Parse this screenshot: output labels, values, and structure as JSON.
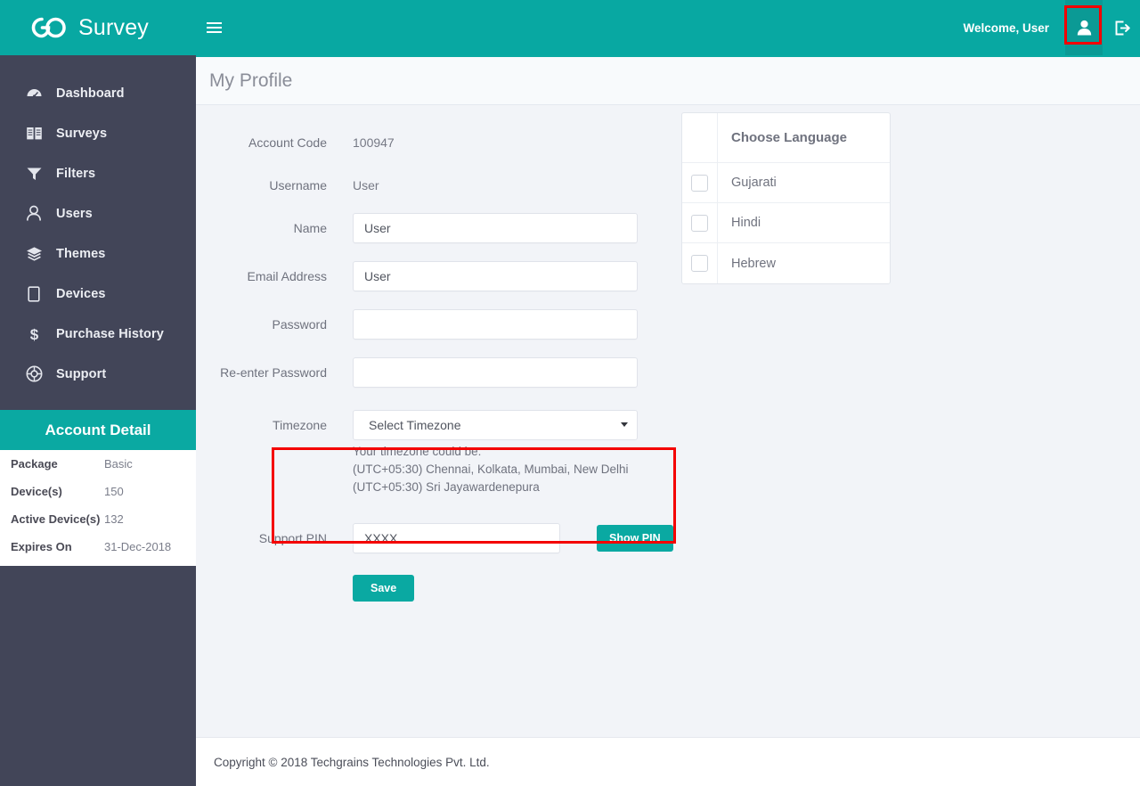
{
  "brand": {
    "name": "Survey",
    "logo_icon": "go-infinity-logo-icon",
    "menu_toggle_icon": "hamburger-icon"
  },
  "topbar": {
    "welcome_text": "Welcome, User",
    "profile_icon": "user-icon",
    "logout_icon": "logout-icon",
    "background_color": "#08a8a2",
    "highlight_color": "#f40000"
  },
  "sidebar": {
    "background_color": "#424558",
    "items": [
      {
        "label": "Dashboard",
        "icon": "dashboard-gauge-icon"
      },
      {
        "label": "Surveys",
        "icon": "book-icon"
      },
      {
        "label": "Filters",
        "icon": "funnel-icon"
      },
      {
        "label": "Users",
        "icon": "user-icon"
      },
      {
        "label": "Themes",
        "icon": "layers-icon"
      },
      {
        "label": "Devices",
        "icon": "tablet-icon"
      },
      {
        "label": "Purchase History",
        "icon": "dollar-icon"
      },
      {
        "label": "Support",
        "icon": "life-ring-icon"
      }
    ],
    "account_detail": {
      "title": "Account Detail",
      "rows": [
        {
          "key": "Package",
          "value": "Basic"
        },
        {
          "key": "Device(s)",
          "value": "150"
        },
        {
          "key": "Active Device(s)",
          "value": "132"
        },
        {
          "key": "Expires On",
          "value": "31-Dec-2018"
        }
      ]
    }
  },
  "page": {
    "title": "My Profile",
    "accent_color": "#0aa9a2"
  },
  "form": {
    "account_code": {
      "label": "Account Code",
      "value": "100947"
    },
    "username": {
      "label": "Username",
      "value": "User"
    },
    "name": {
      "label": "Name",
      "value": "User",
      "placeholder": ""
    },
    "email": {
      "label": "Email Address",
      "value": "User",
      "placeholder": ""
    },
    "password": {
      "label": "Password",
      "value": "",
      "placeholder": ""
    },
    "reenter_password": {
      "label": "Re-enter Password",
      "value": "",
      "placeholder": ""
    },
    "timezone": {
      "label": "Timezone",
      "selected": "Select Timezone",
      "caret_icon": "chevron-down-icon",
      "hint_title": "Your timezone could be:",
      "hint_lines": [
        "(UTC+05:30) Chennai, Kolkata, Mumbai, New Delhi",
        "(UTC+05:30) Sri Jayawardenepura"
      ]
    },
    "support_pin": {
      "label": "Support PIN",
      "value": "XXXX",
      "placeholder": ""
    },
    "show_pin_label": "Show PIN",
    "save_label": "Save"
  },
  "language_panel": {
    "header": "Choose Language",
    "options": [
      {
        "label": "Gujarati",
        "checked": false
      },
      {
        "label": "Hindi",
        "checked": false
      },
      {
        "label": "Hebrew",
        "checked": false
      }
    ]
  },
  "footer": {
    "text": "Copyright © 2018 Techgrains Technologies Pvt. Ltd."
  }
}
